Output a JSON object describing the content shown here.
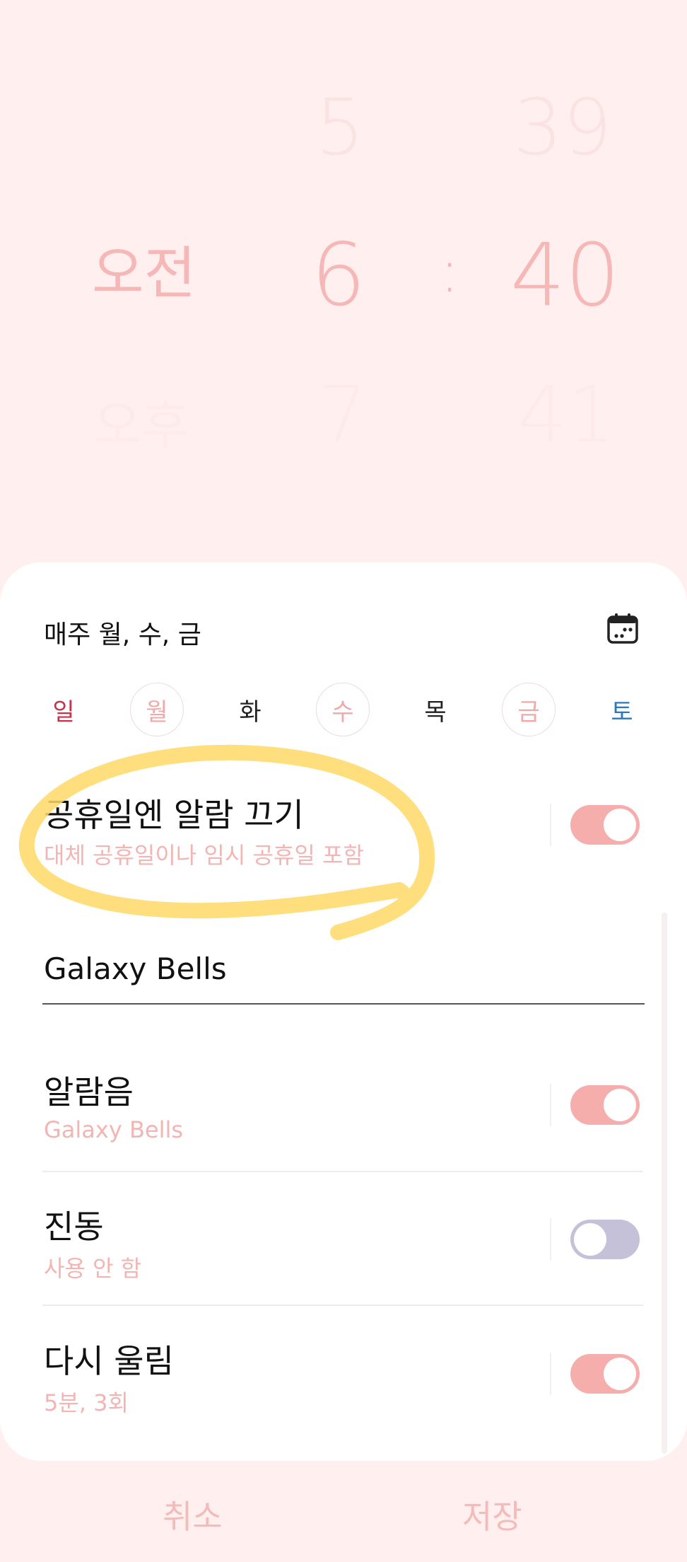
{
  "time_picker": {
    "ampm": {
      "above": "",
      "selected": "오전",
      "below": "오후"
    },
    "hour": {
      "above": "5",
      "selected": "6",
      "below": "7"
    },
    "separator": ":",
    "minute": {
      "above": "39",
      "selected": "40",
      "below": "41"
    }
  },
  "repeat": {
    "label": "매주 월, 수, 금",
    "icon": "calendar-icon",
    "days": [
      {
        "label": "일",
        "selected": false,
        "color": "#c8324a"
      },
      {
        "label": "월",
        "selected": true,
        "color": "#f0a9a8"
      },
      {
        "label": "화",
        "selected": false,
        "color": "#222222"
      },
      {
        "label": "수",
        "selected": true,
        "color": "#f0a9a8"
      },
      {
        "label": "목",
        "selected": false,
        "color": "#222222"
      },
      {
        "label": "금",
        "selected": true,
        "color": "#f0a9a8"
      },
      {
        "label": "토",
        "selected": false,
        "color": "#2f78b8"
      }
    ]
  },
  "holiday": {
    "title": "공휴일엔 알람 끄기",
    "subtitle": "대체 공휴일이나 임시 공휴일 포함",
    "toggle_on": true
  },
  "alarm_name": {
    "value": "Galaxy Bells"
  },
  "settings": [
    {
      "title": "알람음",
      "subtitle": "Galaxy Bells",
      "toggle_on": true
    },
    {
      "title": "진동",
      "subtitle": "사용 안 함",
      "toggle_on": false
    },
    {
      "title": "다시 울림",
      "subtitle": "5분, 3회",
      "toggle_on": true
    }
  ],
  "colors": {
    "background": "#fff0ef",
    "accent": "#f6aeac",
    "toggle_off": "#c4c1d8",
    "highlight_marker": "#ffd966"
  },
  "bottom_bar": {
    "cancel": "취소",
    "save": "저장"
  }
}
